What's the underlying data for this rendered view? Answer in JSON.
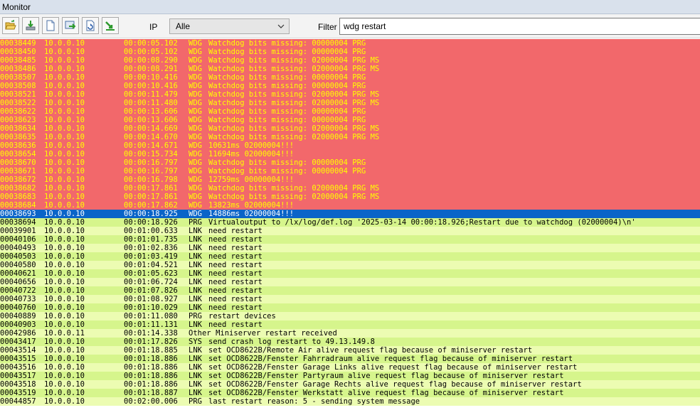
{
  "window": {
    "title": "Monitor"
  },
  "toolbar": {
    "buttons": [
      {
        "name": "open-folder-button",
        "icon": "open-folder-icon"
      },
      {
        "name": "download-button",
        "icon": "download-icon"
      },
      {
        "name": "new-document-button",
        "icon": "new-document-icon"
      },
      {
        "name": "export-button",
        "icon": "export-icon"
      },
      {
        "name": "refresh-button",
        "icon": "refresh-icon"
      },
      {
        "name": "forward-button",
        "icon": "green-arrow-icon"
      }
    ],
    "ip_label": "IP",
    "ip_value": "Alle",
    "filter_label": "Filter",
    "filter_value": "wdg restart"
  },
  "colors": {
    "alarm_row": "#f2686b",
    "alarm_text": "#ffff00",
    "selected_row": "#0a64c8",
    "selected_text": "#ffffff",
    "ok_row_a": "#d6f58c",
    "ok_row_b": "#ecfcb2",
    "ok_text": "#000000"
  },
  "log": [
    {
      "id": "00038449",
      "ip": "10.0.0.10",
      "time": "00:00:05.102",
      "type": "WDG",
      "msg": "Watchdog bits missing: 00000004 PRG",
      "state": "alarm"
    },
    {
      "id": "00038450",
      "ip": "10.0.0.10",
      "time": "00:00:05.102",
      "type": "WDG",
      "msg": "Watchdog bits missing: 00000004 PRG",
      "state": "alarm"
    },
    {
      "id": "00038485",
      "ip": "10.0.0.10",
      "time": "00:00:08.290",
      "type": "WDG",
      "msg": "Watchdog bits missing: 02000004 PRG MS",
      "state": "alarm"
    },
    {
      "id": "00038486",
      "ip": "10.0.0.10",
      "time": "00:00:08.291",
      "type": "WDG",
      "msg": "Watchdog bits missing: 02000004 PRG MS",
      "state": "alarm"
    },
    {
      "id": "00038507",
      "ip": "10.0.0.10",
      "time": "00:00:10.416",
      "type": "WDG",
      "msg": "Watchdog bits missing: 00000004 PRG",
      "state": "alarm"
    },
    {
      "id": "00038508",
      "ip": "10.0.0.10",
      "time": "00:00:10.416",
      "type": "WDG",
      "msg": "Watchdog bits missing: 00000004 PRG",
      "state": "alarm"
    },
    {
      "id": "00038521",
      "ip": "10.0.0.10",
      "time": "00:00:11.479",
      "type": "WDG",
      "msg": "Watchdog bits missing: 02000004 PRG MS",
      "state": "alarm"
    },
    {
      "id": "00038522",
      "ip": "10.0.0.10",
      "time": "00:00:11.480",
      "type": "WDG",
      "msg": "Watchdog bits missing: 02000004 PRG MS",
      "state": "alarm"
    },
    {
      "id": "00038622",
      "ip": "10.0.0.10",
      "time": "00:00:13.606",
      "type": "WDG",
      "msg": "Watchdog bits missing: 00000004 PRG",
      "state": "alarm"
    },
    {
      "id": "00038623",
      "ip": "10.0.0.10",
      "time": "00:00:13.606",
      "type": "WDG",
      "msg": "Watchdog bits missing: 00000004 PRG",
      "state": "alarm"
    },
    {
      "id": "00038634",
      "ip": "10.0.0.10",
      "time": "00:00:14.669",
      "type": "WDG",
      "msg": "Watchdog bits missing: 02000004 PRG MS",
      "state": "alarm"
    },
    {
      "id": "00038635",
      "ip": "10.0.0.10",
      "time": "00:00:14.670",
      "type": "WDG",
      "msg": "Watchdog bits missing: 02000004 PRG MS",
      "state": "alarm"
    },
    {
      "id": "00038636",
      "ip": "10.0.0.10",
      "time": "00:00:14.671",
      "type": "WDG",
      "msg": "10631ms 02000004!!!",
      "state": "alarm"
    },
    {
      "id": "00038654",
      "ip": "10.0.0.10",
      "time": "00:00:15.734",
      "type": "WDG",
      "msg": "11694ms 02000004!!!",
      "state": "alarm"
    },
    {
      "id": "00038670",
      "ip": "10.0.0.10",
      "time": "00:00:16.797",
      "type": "WDG",
      "msg": "Watchdog bits missing: 00000004 PRG",
      "state": "alarm"
    },
    {
      "id": "00038671",
      "ip": "10.0.0.10",
      "time": "00:00:16.797",
      "type": "WDG",
      "msg": "Watchdog bits missing: 00000004 PRG",
      "state": "alarm"
    },
    {
      "id": "00038672",
      "ip": "10.0.0.10",
      "time": "00:00:16.798",
      "type": "WDG",
      "msg": "12759ms 00000004!!!",
      "state": "alarm"
    },
    {
      "id": "00038682",
      "ip": "10.0.0.10",
      "time": "00:00:17.861",
      "type": "WDG",
      "msg": "Watchdog bits missing: 02000004 PRG MS",
      "state": "alarm"
    },
    {
      "id": "00038683",
      "ip": "10.0.0.10",
      "time": "00:00:17.861",
      "type": "WDG",
      "msg": "Watchdog bits missing: 02000004 PRG MS",
      "state": "alarm"
    },
    {
      "id": "00038684",
      "ip": "10.0.0.10",
      "time": "00:00:17.862",
      "type": "WDG",
      "msg": "13823ms 02000004!!!",
      "state": "alarm"
    },
    {
      "id": "00038693",
      "ip": "10.0.0.10",
      "time": "00:00:18.925",
      "type": "WDG",
      "msg": "14886ms 02000004!!!",
      "state": "selected"
    },
    {
      "id": "00038694",
      "ip": "10.0.0.10",
      "time": "00:00:18.926",
      "type": "PRG",
      "msg": "Virtualoutput to /lx/log/def.log '2025-03-14 00:00:18.926;Restart due to watchdog (02000004)\\n'",
      "state": "ok"
    },
    {
      "id": "00039901",
      "ip": "10.0.0.10",
      "time": "00:01:00.633",
      "type": "LNK",
      "msg": "need restart",
      "state": "ok"
    },
    {
      "id": "00040106",
      "ip": "10.0.0.10",
      "time": "00:01:01.735",
      "type": "LNK",
      "msg": "need restart",
      "state": "ok"
    },
    {
      "id": "00040493",
      "ip": "10.0.0.10",
      "time": "00:01:02.836",
      "type": "LNK",
      "msg": "need restart",
      "state": "ok"
    },
    {
      "id": "00040503",
      "ip": "10.0.0.10",
      "time": "00:01:03.419",
      "type": "LNK",
      "msg": "need restart",
      "state": "ok"
    },
    {
      "id": "00040580",
      "ip": "10.0.0.10",
      "time": "00:01:04.521",
      "type": "LNK",
      "msg": "need restart",
      "state": "ok"
    },
    {
      "id": "00040621",
      "ip": "10.0.0.10",
      "time": "00:01:05.623",
      "type": "LNK",
      "msg": "need restart",
      "state": "ok"
    },
    {
      "id": "00040656",
      "ip": "10.0.0.10",
      "time": "00:01:06.724",
      "type": "LNK",
      "msg": "need restart",
      "state": "ok"
    },
    {
      "id": "00040722",
      "ip": "10.0.0.10",
      "time": "00:01:07.826",
      "type": "LNK",
      "msg": "need restart",
      "state": "ok"
    },
    {
      "id": "00040733",
      "ip": "10.0.0.10",
      "time": "00:01:08.927",
      "type": "LNK",
      "msg": "need restart",
      "state": "ok"
    },
    {
      "id": "00040760",
      "ip": "10.0.0.10",
      "time": "00:01:10.029",
      "type": "LNK",
      "msg": "need restart",
      "state": "ok"
    },
    {
      "id": "00040889",
      "ip": "10.0.0.10",
      "time": "00:01:11.080",
      "type": "PRG",
      "msg": "restart devices",
      "state": "ok"
    },
    {
      "id": "00040903",
      "ip": "10.0.0.10",
      "time": "00:01:11.131",
      "type": "LNK",
      "msg": "need restart",
      "state": "ok"
    },
    {
      "id": "00042986",
      "ip": "10.0.0.11",
      "time": "00:01:14.338",
      "type": "Other",
      "msg": "Miniserver restart received",
      "state": "ok"
    },
    {
      "id": "00043417",
      "ip": "10.0.0.10",
      "time": "00:01:17.826",
      "type": "SYS",
      "msg": "send crash log restart to 49.13.149.8",
      "state": "ok"
    },
    {
      "id": "00043514",
      "ip": "10.0.0.10",
      "time": "00:01:18.885",
      "type": "LNK",
      "msg": "set OCD8622B/Remote Air alive request flag because of miniserver restart",
      "state": "ok"
    },
    {
      "id": "00043515",
      "ip": "10.0.0.10",
      "time": "00:01:18.886",
      "type": "LNK",
      "msg": "set OCD8622B/Fenster Fahrradraum alive request flag because of miniserver restart",
      "state": "ok"
    },
    {
      "id": "00043516",
      "ip": "10.0.0.10",
      "time": "00:01:18.886",
      "type": "LNK",
      "msg": "set OCD8622B/Fenster Garage Links alive request flag because of miniserver restart",
      "state": "ok"
    },
    {
      "id": "00043517",
      "ip": "10.0.0.10",
      "time": "00:01:18.886",
      "type": "LNK",
      "msg": "set OCD8622B/Fenster Partyraum alive request flag because of miniserver restart",
      "state": "ok"
    },
    {
      "id": "00043518",
      "ip": "10.0.0.10",
      "time": "00:01:18.886",
      "type": "LNK",
      "msg": "set OCD8622B/Fenster Garage Rechts alive request flag because of miniserver restart",
      "state": "ok"
    },
    {
      "id": "00043519",
      "ip": "10.0.0.10",
      "time": "00:01:18.887",
      "type": "LNK",
      "msg": "set OCD8622B/Fenster Werkstatt alive request flag because of miniserver restart",
      "state": "ok"
    },
    {
      "id": "00044857",
      "ip": "10.0.0.10",
      "time": "00:02:00.006",
      "type": "PRG",
      "msg": "last restart reason: 5 - sending system message",
      "state": "ok"
    }
  ]
}
